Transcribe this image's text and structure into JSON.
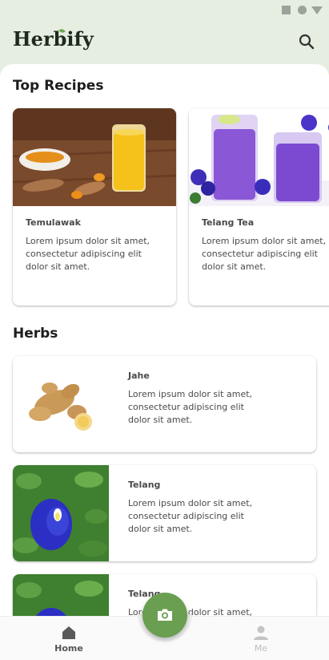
{
  "app": {
    "title": "Herbify"
  },
  "status_bar": {
    "icons": [
      "square-icon",
      "circle-icon",
      "triangle-icon"
    ]
  },
  "header": {
    "search_icon": "search-icon"
  },
  "sections": {
    "top_recipes": {
      "title": "Top Recipes",
      "items": [
        {
          "title": "Temulawak",
          "description": "Lorem ipsum dolor sit amet, consectetur adipiscing elit dolor sit amet."
        },
        {
          "title": "Telang Tea",
          "description": "Lorem ipsum dolor sit amet, consectetur adipiscing elit dolor sit amet."
        }
      ]
    },
    "herbs": {
      "title": "Herbs",
      "items": [
        {
          "title": "Jahe",
          "description": "Lorem ipsum dolor sit amet, consectetur adipiscing elit dolor sit amet."
        },
        {
          "title": "Telang",
          "description": "Lorem ipsum dolor sit amet, consectetur adipiscing elit dolor sit amet."
        },
        {
          "title": "Telang",
          "description": "Lorem ipsum dolor sit amet, consectetur adipiscing elit dolor sit amet."
        }
      ]
    }
  },
  "bottom_nav": {
    "items": [
      {
        "label": "Home",
        "icon": "home-icon",
        "active": true
      },
      {
        "label": "Me",
        "icon": "person-icon",
        "active": false
      }
    ],
    "fab_icon": "camera-icon"
  },
  "colors": {
    "background": "#e6eee1",
    "accent": "#6a9e50",
    "surface": "#ffffff"
  }
}
